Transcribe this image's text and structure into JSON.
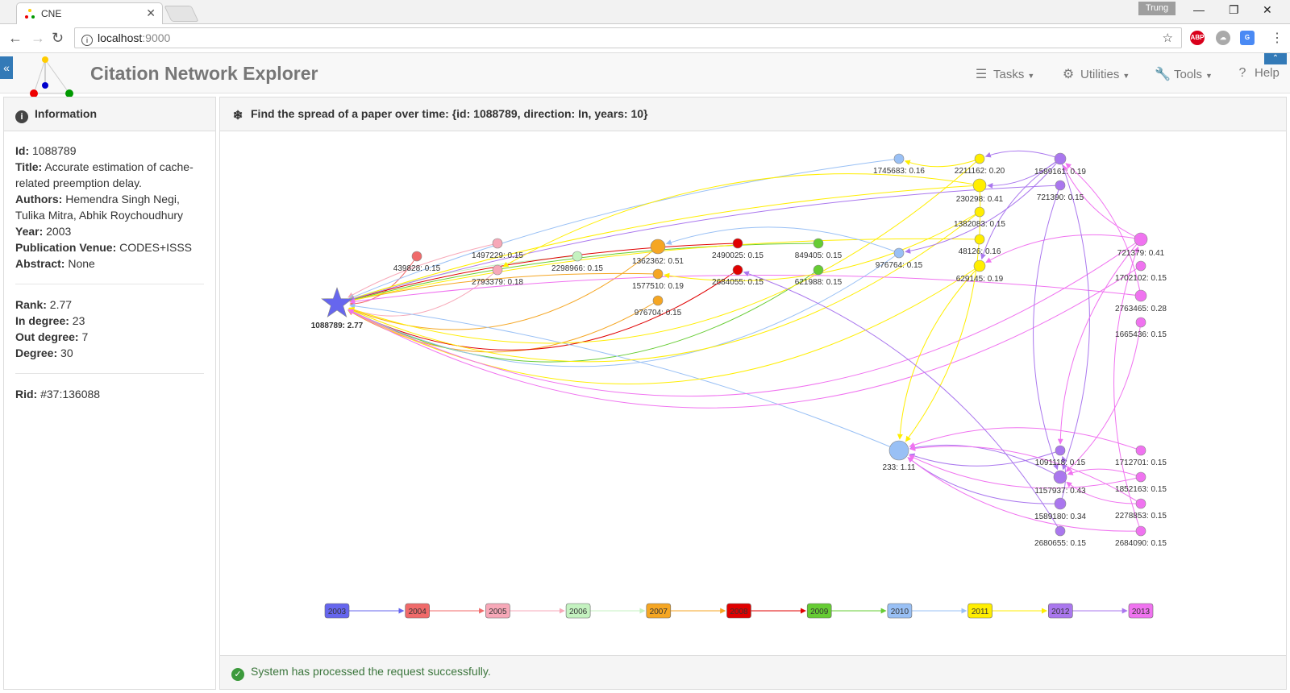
{
  "browser": {
    "tab_title": "CNE",
    "user": "Trung",
    "url_host": "localhost",
    "url_port": ":9000"
  },
  "app": {
    "title": "Citation Network Explorer",
    "menu": [
      "Tasks",
      "Utilities",
      "Tools",
      "Help"
    ]
  },
  "info_panel": {
    "heading": "Information",
    "id_label": "Id:",
    "id": "1088789",
    "title_label": "Title:",
    "title": "Accurate estimation of cache-related preemption delay.",
    "authors_label": "Authors:",
    "authors": "Hemendra Singh Negi, Tulika Mitra, Abhik Roychoudhury",
    "year_label": "Year:",
    "year": "2003",
    "venue_label": "Publication Venue:",
    "venue": "CODES+ISSS",
    "abstract_label": "Abstract:",
    "abstract": "None",
    "rank_label": "Rank:",
    "rank": "2.77",
    "indeg_label": "In degree:",
    "indeg": "23",
    "outdeg_label": "Out degree:",
    "outdeg": "7",
    "deg_label": "Degree:",
    "deg": "30",
    "rid_label": "Rid:",
    "rid": "#37:136088"
  },
  "graph_panel": {
    "heading": "Find the spread of a paper over time: {id: 1088789, direction: In, years: 10}",
    "status": "System has processed the request successfully."
  },
  "year_colors": {
    "2003": "#6666ee",
    "2004": "#f06a6a",
    "2005": "#f7a8b8",
    "2006": "#c4f2c0",
    "2007": "#f5a623",
    "2008": "#e00000",
    "2009": "#66cc33",
    "2010": "#99c0f5",
    "2011": "#ffee00",
    "2012": "#aa77ee",
    "2013": "#f073f0"
  },
  "timeline": [
    "2003",
    "2004",
    "2005",
    "2006",
    "2007",
    "2008",
    "2009",
    "2010",
    "2011",
    "2012",
    "2013"
  ],
  "nodes": [
    {
      "id": "1088789",
      "label": "1088789: 2.77",
      "year": "2003",
      "star": true
    },
    {
      "id": "439828",
      "label": "439828: 0.15",
      "year": "2004"
    },
    {
      "id": "1497229",
      "label": "1497229: 0.15",
      "year": "2005"
    },
    {
      "id": "2793379",
      "label": "2793379: 0.18",
      "year": "2005"
    },
    {
      "id": "2298966",
      "label": "2298966: 0.15",
      "year": "2006"
    },
    {
      "id": "1362362",
      "label": "1362362: 0.51",
      "year": "2007"
    },
    {
      "id": "1577510",
      "label": "1577510: 0.19",
      "year": "2007"
    },
    {
      "id": "976704",
      "label": "976704: 0.15",
      "year": "2007"
    },
    {
      "id": "2490025",
      "label": "2490025: 0.15",
      "year": "2008"
    },
    {
      "id": "2684055",
      "label": "2684055: 0.15",
      "year": "2008"
    },
    {
      "id": "849405",
      "label": "849405: 0.15",
      "year": "2009"
    },
    {
      "id": "621988",
      "label": "621988: 0.15",
      "year": "2009"
    },
    {
      "id": "1745683",
      "label": "1745683: 0.16",
      "year": "2010"
    },
    {
      "id": "976764",
      "label": "976764: 0.15",
      "year": "2010"
    },
    {
      "id": "233",
      "label": "233: 1.11",
      "year": "2010"
    },
    {
      "id": "2211162",
      "label": "2211162: 0.20",
      "year": "2011"
    },
    {
      "id": "230298",
      "label": "230298: 0.41",
      "year": "2011"
    },
    {
      "id": "1382083",
      "label": "1382083: 0.15",
      "year": "2011"
    },
    {
      "id": "48126",
      "label": "48126: 0.16",
      "year": "2011"
    },
    {
      "id": "629145",
      "label": "629145: 0.19",
      "year": "2011"
    },
    {
      "id": "1589161",
      "label": "1589161: 0.19",
      "year": "2012"
    },
    {
      "id": "721390",
      "label": "721390: 0.15",
      "year": "2012"
    },
    {
      "id": "1091118",
      "label": "1091118: 0.15",
      "year": "2012"
    },
    {
      "id": "1157937",
      "label": "1157937: 0.43",
      "year": "2012"
    },
    {
      "id": "1589180",
      "label": "1589180: 0.34",
      "year": "2012"
    },
    {
      "id": "2680655",
      "label": "2680655: 0.15",
      "year": "2012"
    },
    {
      "id": "721379",
      "label": "721379: 0.41",
      "year": "2013"
    },
    {
      "id": "1702102",
      "label": "1702102: 0.15",
      "year": "2013"
    },
    {
      "id": "2763465",
      "label": "2763465: 0.28",
      "year": "2013"
    },
    {
      "id": "1665436",
      "label": "1665436: 0.15",
      "year": "2013"
    },
    {
      "id": "1712701",
      "label": "1712701: 0.15",
      "year": "2013"
    },
    {
      "id": "1852163",
      "label": "1852163: 0.15",
      "year": "2013"
    },
    {
      "id": "2278853",
      "label": "2278853: 0.15",
      "year": "2013"
    },
    {
      "id": "2684090",
      "label": "2684090: 0.15",
      "year": "2013"
    }
  ],
  "edges": [
    [
      "439828",
      "1088789"
    ],
    [
      "1497229",
      "1088789"
    ],
    [
      "2793379",
      "1088789"
    ],
    [
      "2298966",
      "1088789"
    ],
    [
      "1362362",
      "1088789"
    ],
    [
      "1577510",
      "1088789"
    ],
    [
      "976704",
      "1088789"
    ],
    [
      "2490025",
      "1088789"
    ],
    [
      "2684055",
      "1088789"
    ],
    [
      "849405",
      "1088789"
    ],
    [
      "621988",
      "1088789"
    ],
    [
      "1745683",
      "1088789"
    ],
    [
      "976764",
      "1088789"
    ],
    [
      "233",
      "1088789"
    ],
    [
      "2211162",
      "1088789"
    ],
    [
      "230298",
      "1088789"
    ],
    [
      "1382083",
      "1088789"
    ],
    [
      "48126",
      "1088789"
    ],
    [
      "629145",
      "1088789"
    ],
    [
      "721390",
      "1088789"
    ],
    [
      "721379",
      "1088789"
    ],
    [
      "2763465",
      "1088789"
    ],
    [
      "1702102",
      "1088789"
    ],
    [
      "976764",
      "1362362"
    ],
    [
      "2211162",
      "1745683"
    ],
    [
      "230298",
      "2793379"
    ],
    [
      "1382083",
      "1577510"
    ],
    [
      "1589161",
      "2211162"
    ],
    [
      "1589161",
      "230298"
    ],
    [
      "1589161",
      "629145"
    ],
    [
      "1589161",
      "976764"
    ],
    [
      "721379",
      "629145"
    ],
    [
      "721379",
      "1589161"
    ],
    [
      "2763465",
      "1589161"
    ],
    [
      "230298",
      "233"
    ],
    [
      "629145",
      "233"
    ],
    [
      "1091118",
      "233"
    ],
    [
      "1157937",
      "233"
    ],
    [
      "1589180",
      "233"
    ],
    [
      "1712701",
      "233"
    ],
    [
      "1852163",
      "233"
    ],
    [
      "2278853",
      "233"
    ],
    [
      "2684090",
      "233"
    ],
    [
      "2680655",
      "2684055"
    ],
    [
      "1589161",
      "1157937"
    ],
    [
      "721390",
      "1157937"
    ],
    [
      "1665436",
      "1157937"
    ],
    [
      "1852163",
      "1157937"
    ],
    [
      "2278853",
      "1157937"
    ],
    [
      "721379",
      "1091118"
    ],
    [
      "2684090",
      "721379"
    ],
    [
      "1589180",
      "1091118"
    ]
  ]
}
